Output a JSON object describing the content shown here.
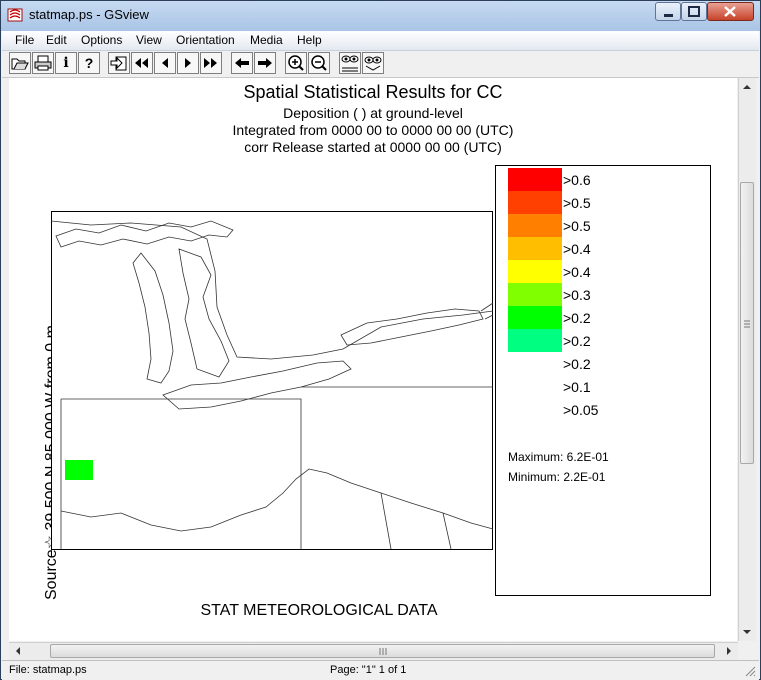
{
  "window": {
    "title": "statmap.ps - GSview"
  },
  "menu": [
    "File",
    "Edit",
    "Options",
    "View",
    "Orientation",
    "Media",
    "Help"
  ],
  "toolbar": [
    "open-icon",
    "print-icon",
    "info-icon",
    "help-icon",
    "goto-page-icon",
    "first-page-icon",
    "prev-page-icon",
    "next-page-icon",
    "last-page-icon",
    "back-icon",
    "forward-icon",
    "zoom-in-icon",
    "zoom-out-icon",
    "preview-text-icon",
    "preview-icon"
  ],
  "document": {
    "title": "Spatial Statistical Results for CC",
    "line1": "Deposition  (  ) at ground-level",
    "line2": "Integrated from 0000 00  to 0000 00  00 (UTC)",
    "line3": "corr Release started at 0000 00  00 (UTC)",
    "side_label": "Source☆ 39.500  N  85.000  W     from     0 m",
    "footer": "STAT METEOROLOGICAL DATA"
  },
  "legend": {
    "items": [
      {
        "label": ">0.6",
        "color": "#ff0000"
      },
      {
        "label": ">0.5",
        "color": "#ff4000"
      },
      {
        "label": ">0.5",
        "color": "#ff8000"
      },
      {
        "label": ">0.4",
        "color": "#ffbf00"
      },
      {
        "label": ">0.4",
        "color": "#ffff00"
      },
      {
        "label": ">0.3",
        "color": "#80ff00"
      },
      {
        "label": ">0.2",
        "color": "#00ff00"
      },
      {
        "label": ">0.2",
        "color": "#00ff80"
      },
      {
        "label": ">0.2",
        "color": ""
      },
      {
        "label": ">0.1",
        "color": ""
      },
      {
        "label": ">0.05",
        "color": ""
      }
    ],
    "maximum": "Maximum: 6.2E-01",
    "minimum": "Minimum: 2.2E-01"
  },
  "status": {
    "file": "File: statmap.ps",
    "page": "Page: \"1\"  1 of 1"
  }
}
